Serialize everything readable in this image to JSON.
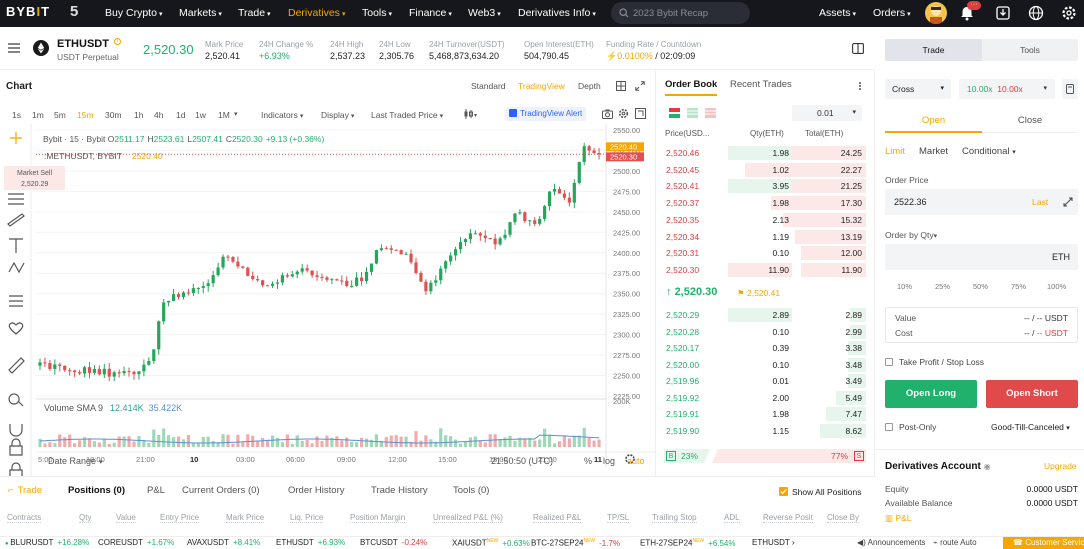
{
  "nav": {
    "logo_text": "BYB",
    "logo_accent": "I",
    "logo_end": "T",
    "badge": "5",
    "items": [
      {
        "label": "Buy Crypto",
        "caret": true,
        "active": false
      },
      {
        "label": "Markets",
        "caret": true,
        "active": false
      },
      {
        "label": "Trade",
        "caret": true,
        "active": false
      },
      {
        "label": "Derivatives",
        "caret": true,
        "active": true
      },
      {
        "label": "Tools",
        "caret": true,
        "active": false
      },
      {
        "label": "Finance",
        "caret": true,
        "active": false
      },
      {
        "label": "Web3",
        "caret": true,
        "active": false
      },
      {
        "label": "Derivatives Info",
        "caret": true,
        "active": false
      }
    ],
    "search_placeholder": "2023 Bybit Recap",
    "assets_label": "Assets",
    "orders_label": "Orders",
    "notif_badge": "···",
    "accent_color": "#f7a600"
  },
  "ticker": {
    "symbol": "ETHUSDT",
    "subtitle": "USDT Perpetual",
    "last_price": "2,520.30",
    "stats": [
      {
        "label": "Mark Price",
        "value": "2,520.41"
      },
      {
        "label": "24H Change %",
        "value": "+6.93%"
      },
      {
        "label": "24H High",
        "value": "2,537.23"
      },
      {
        "label": "24H Low",
        "value": "2,305.76"
      },
      {
        "label": "24H Turnover(USDT)",
        "value": "5,468,873,634.20"
      },
      {
        "label": "Open Interest(ETH)",
        "value": "504,790.45"
      },
      {
        "label": "Funding Rate / Countdown",
        "value_rate": "0.0100%",
        "value_sep": " / ",
        "value_countdown": "02:09:09"
      }
    ]
  },
  "chart": {
    "title": "Chart",
    "views": [
      "Standard",
      "TradingView",
      "Depth"
    ],
    "active_view": "TradingView",
    "intervals": [
      "1s",
      "1m",
      "5m",
      "15m",
      "30m",
      "1h",
      "4h",
      "1d",
      "1w",
      "1M"
    ],
    "active_interval": "15m",
    "tools": [
      {
        "label": "Indicators"
      },
      {
        "label": "Display"
      },
      {
        "label": "Last Traded Price"
      }
    ],
    "tv_alert": "TradingView Alert",
    "legend_symbol": "Bybit · 15 · Bybit",
    "ohlc": {
      "o_label": "O",
      "o": "2511.17",
      "h_label": "H",
      "h": "2523.61",
      "l_label": "L",
      "l": "2507.41",
      "c_label": "C",
      "c": "2520.30",
      "chg": "+9.13 (+0.36%)"
    },
    "mark_legend_symbol": ":METHUSDT, BYBIT",
    "mark_legend_value": "2520.40",
    "market_sell": {
      "label": "Market Sell",
      "value": "2,520.29"
    },
    "price_axis": [
      "2550.00",
      "2525.00",
      "2500.00",
      "2475.00",
      "2450.00",
      "2425.00",
      "2400.00",
      "2375.00",
      "2350.00",
      "2325.00",
      "2300.00",
      "2275.00",
      "2250.00",
      "2225.00"
    ],
    "price_tag_mark": "2520.40",
    "price_tag_last": "2520.30",
    "volume_axis": "200K",
    "volume_label": "Volume SMA 9",
    "volume_val1": "12.414K",
    "volume_val2": "35.422K",
    "time_axis": [
      "5:00",
      "18:00",
      "21:00",
      "10",
      "03:00",
      "06:00",
      "09:00",
      "12:00",
      "15:00",
      "18:00",
      "21:00",
      "11"
    ],
    "date_range": "Date Range",
    "clock": "21:50:50 (UTC)",
    "bottom_opts": [
      "%",
      "log",
      "auto"
    ],
    "ylim": [
      2225,
      2550
    ],
    "y_top_value": 2550,
    "y_bottom_value": 2225,
    "candles_seed": "ETHUSDT-15m"
  },
  "orderbook": {
    "tabs": [
      "Order Book",
      "Recent Trades"
    ],
    "active_tab": "Order Book",
    "precision": "0.01",
    "headers": [
      "Price(USD...",
      "Qty(ETH)",
      "Total(ETH)"
    ],
    "asks": [
      {
        "price": "2,520.46",
        "qty": "1.98",
        "total": "24.25",
        "depth": 0.66
      },
      {
        "price": "2,520.45",
        "qty": "1.02",
        "total": "22.27",
        "depth": 0.6
      },
      {
        "price": "2,520.41",
        "qty": "3.95",
        "total": "21.25",
        "depth": 0.57
      },
      {
        "price": "2,520.37",
        "qty": "1.98",
        "total": "17.30",
        "depth": 0.47
      },
      {
        "price": "2,520.35",
        "qty": "2.13",
        "total": "15.32",
        "depth": 0.41
      },
      {
        "price": "2,520.34",
        "qty": "1.19",
        "total": "13.19",
        "depth": 0.35
      },
      {
        "price": "2,520.31",
        "qty": "0.10",
        "total": "12.00",
        "depth": 0.32
      },
      {
        "price": "2,520.30",
        "qty": "11.90",
        "total": "11.90",
        "depth": 0.32
      }
    ],
    "ask_qty_hl": [
      0,
      2
    ],
    "mid_price": "2,520.30",
    "mid_mark": "2,520.41",
    "bids": [
      {
        "price": "2,520.29",
        "qty": "2.89",
        "total": "2.89",
        "depth": 0.08
      },
      {
        "price": "2,520.28",
        "qty": "0.10",
        "total": "2.99",
        "depth": 0.08
      },
      {
        "price": "2,520.17",
        "qty": "0.39",
        "total": "3.38",
        "depth": 0.09
      },
      {
        "price": "2,520.00",
        "qty": "0.10",
        "total": "3.48",
        "depth": 0.09
      },
      {
        "price": "2,519.96",
        "qty": "0.01",
        "total": "3.49",
        "depth": 0.09
      },
      {
        "price": "2,519.92",
        "qty": "2.00",
        "total": "5.49",
        "depth": 0.15
      },
      {
        "price": "2,519.91",
        "qty": "1.98",
        "total": "7.47",
        "depth": 0.2
      },
      {
        "price": "2,519.90",
        "qty": "1.15",
        "total": "8.62",
        "depth": 0.23
      }
    ],
    "buy_badge": "B",
    "buy_pct": "23%",
    "sell_pct": "77%",
    "sell_badge": "S",
    "buy_ratio": 0.23
  },
  "trade_panel": {
    "tabs": [
      "Trade",
      "Tools"
    ],
    "active_tab": "Trade",
    "margin_mode": "Cross",
    "leverage_long": "10.00x",
    "leverage_short": "10.00x",
    "open_close": [
      "Open",
      "Close"
    ],
    "order_types": [
      "Limit",
      "Market",
      "Conditional"
    ],
    "order_price_label": "Order Price",
    "order_price_value": "2522.36",
    "last_label": "Last",
    "qty_label": "Order by Qty",
    "qty_unit": "ETH",
    "percents": [
      "10%",
      "25%",
      "50%",
      "75%",
      "100%"
    ],
    "value_label": "Value",
    "value_amount": "-- / -- USDT",
    "value_pre": "-- / ",
    "value_post": "-- USDT",
    "cost_label": "Cost",
    "cost_pre": "-- / ",
    "cost_post": "-- USDT",
    "tpsl_label": "Take Profit / Stop Loss",
    "long_btn": "Open Long",
    "short_btn": "Open Short",
    "post_only": "Post-Only",
    "tif": "Good-Till-Canceled",
    "account_title": "Derivatives Account",
    "upgrade": "Upgrade",
    "equity_label": "Equity",
    "equity_value": "0.0000 USDT",
    "avail_label": "Available Balance",
    "avail_value": "0.0000 USDT",
    "pnl_label": "P&L"
  },
  "positions": {
    "tabs": [
      "Trade",
      "Positions (0)",
      "P&L",
      "Current Orders (0)",
      "Order History",
      "Trade History",
      "Tools (0)"
    ],
    "show_all": "Show All Positions",
    "columns": [
      "Contracts",
      "Qty",
      "Value",
      "Entry Price",
      "Mark Price",
      "Liq. Price",
      "Position Margin",
      "Unrealized P&L (%)",
      "Realized P&L",
      "TP/SL",
      "Trailing Stop",
      "ADL",
      "Reverse Posit",
      "Close By"
    ]
  },
  "bottom_ticker": {
    "items": [
      {
        "sym": "BLURUSDT",
        "chg": "+16.28%",
        "up": true,
        "new": false
      },
      {
        "sym": "COREUSDT",
        "chg": "+1.67%",
        "up": true,
        "new": false
      },
      {
        "sym": "AVAXUSDT",
        "chg": "+8.41%",
        "up": true,
        "new": false
      },
      {
        "sym": "ETHUSDT",
        "chg": "+6.93%",
        "up": true,
        "new": false
      },
      {
        "sym": "BTCUSDT",
        "chg": "-0.24%",
        "up": false,
        "new": false
      },
      {
        "sym": "XAIUSDT",
        "chg": "+0.63%",
        "up": true,
        "new": true
      },
      {
        "sym": "BTC-27SEP24",
        "chg": "-1.7%",
        "up": false,
        "new": true
      },
      {
        "sym": "ETH-27SEP24",
        "chg": "+6.54%",
        "up": true,
        "new": true
      },
      {
        "sym": "ETHUSDT",
        "chg": "",
        "up": true,
        "new": false
      }
    ],
    "new_label": "NEW",
    "announcements": "Announcements",
    "route": "route Auto",
    "customer_service": "Customer Service"
  }
}
